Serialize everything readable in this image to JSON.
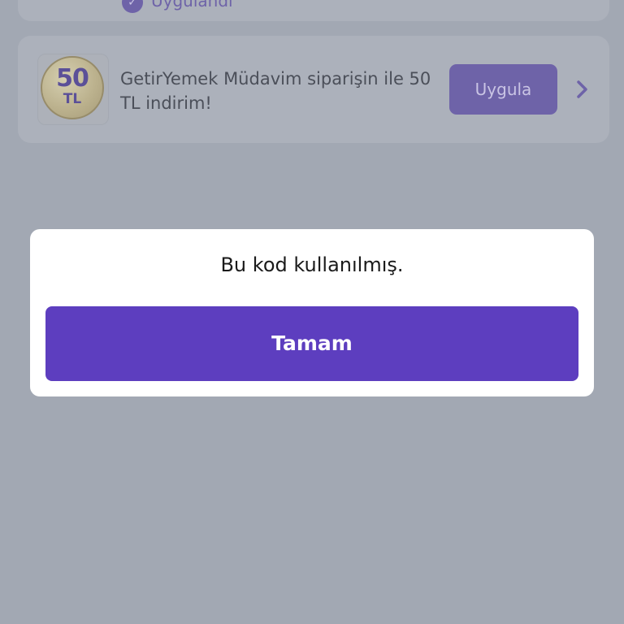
{
  "colors": {
    "overlay_background": "#a2a8b3",
    "card_background": "#acb1bb",
    "brand_purple": "#5d3ebf",
    "dimmed_purple": "#6e63a8",
    "dialog_background": "#ffffff"
  },
  "background_list": {
    "top_item": {
      "status_label": "Uygulandı",
      "status_icon": "check-circle-icon"
    },
    "promo_item": {
      "coin_amount": "50",
      "coin_unit": "TL",
      "description": "GetirYemek Müdavim siparişin ile 50 TL indirim!",
      "apply_label": "Uygula",
      "arrow_icon": "chevron-right-icon"
    }
  },
  "dialog": {
    "message": "Bu kod kullanılmış.",
    "ok_label": "Tamam"
  }
}
